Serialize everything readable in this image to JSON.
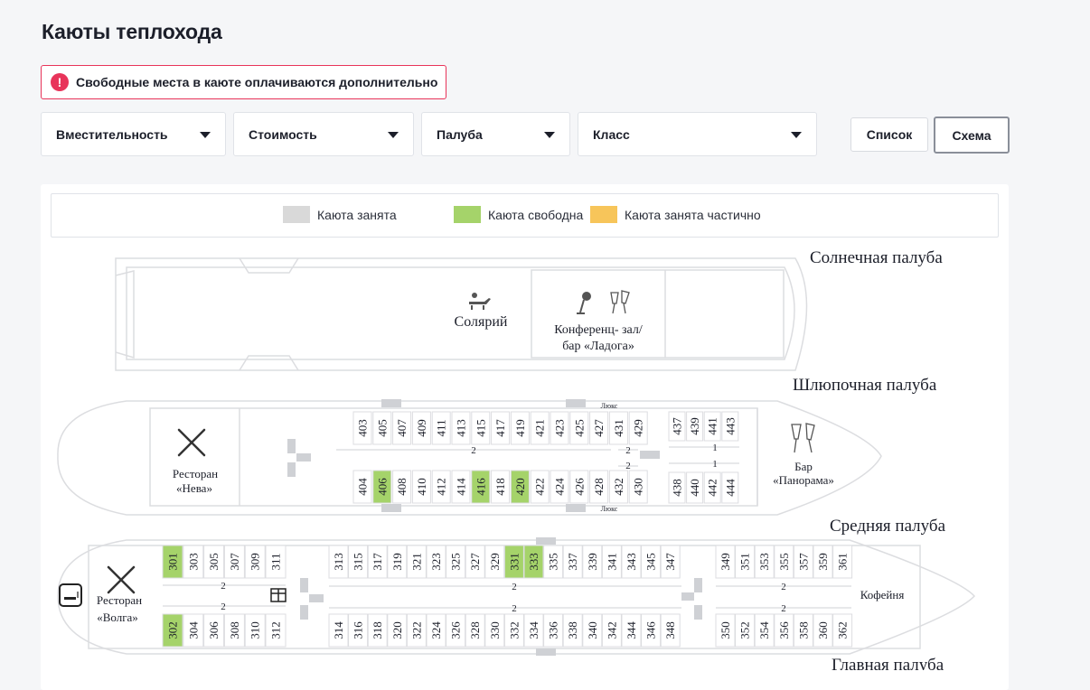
{
  "page": {
    "title": "Каюты теплохода"
  },
  "alert": {
    "icon": "exclamation-icon",
    "text": "Свободные места в каюте оплачиваются дополнительно",
    "color": "#e8345a"
  },
  "filters": [
    {
      "label": "Вместительность"
    },
    {
      "label": "Стоимость"
    },
    {
      "label": "Палуба"
    },
    {
      "label": "Класс"
    }
  ],
  "view": {
    "list_label": "Список",
    "scheme_label": "Схема",
    "active": "Схема"
  },
  "legend": [
    {
      "label": "Каюта занята",
      "color": "#d9d9d9"
    },
    {
      "label": "Каюта свободна",
      "color": "#a5d36a"
    },
    {
      "label": "Каюта занята частично",
      "color": "#f7c55a"
    }
  ],
  "decks": {
    "sun": {
      "name": "Солнечная палуба",
      "solarium": "Солярий",
      "conf_line1": "Конференц- зал/",
      "conf_line2": "бар «Ладога»"
    },
    "boat": {
      "name": "Шлюпочная палуба",
      "restaurant_line1": "Ресторан",
      "restaurant_line2": "«Нева»",
      "bar_line1": "Бар",
      "bar_line2": "«Панорама»",
      "lux": "Люкс",
      "top_cabins": [
        "403",
        "405",
        "407",
        "409",
        "411",
        "413",
        "415",
        "417",
        "419",
        "421",
        "423",
        "425",
        "427",
        "431",
        "429"
      ],
      "top_right_cabins": [
        "437",
        "439",
        "441",
        "443"
      ],
      "bottom_cabins": [
        "404",
        "406",
        "408",
        "410",
        "412",
        "414",
        "416",
        "418",
        "420",
        "422",
        "424",
        "426",
        "428",
        "432",
        "430"
      ],
      "bottom_right_cabins": [
        "438",
        "440",
        "442",
        "444"
      ],
      "free": [
        "406",
        "416",
        "420"
      ],
      "berth_main": "2",
      "berth_small": "2",
      "berth_right": "1"
    },
    "middle": {
      "name": "Средняя палуба",
      "restaurant_line1": "Ресторан",
      "restaurant_line2": "«Волга»",
      "cafe": "Кофейня",
      "top_left_cabins": [
        "301",
        "303",
        "305",
        "307",
        "309",
        "311"
      ],
      "top_mid_cabins": [
        "313",
        "315",
        "317",
        "319",
        "321",
        "323",
        "325",
        "327",
        "329",
        "331",
        "333",
        "335",
        "337",
        "339",
        "341",
        "343",
        "345",
        "347"
      ],
      "top_right_cabins": [
        "349",
        "351",
        "353",
        "355",
        "357",
        "359",
        "361"
      ],
      "bottom_left_cabins": [
        "302",
        "304",
        "306",
        "308",
        "310",
        "312"
      ],
      "bottom_mid_cabins": [
        "314",
        "316",
        "318",
        "320",
        "322",
        "324",
        "326",
        "328",
        "330",
        "332",
        "334",
        "336",
        "338",
        "340",
        "342",
        "344",
        "346",
        "348"
      ],
      "bottom_right_cabins": [
        "350",
        "352",
        "354",
        "356",
        "358",
        "360",
        "362"
      ],
      "free": [
        "301",
        "302",
        "331",
        "333"
      ],
      "berth": "2"
    },
    "main": {
      "name": "Главная палуба"
    }
  }
}
